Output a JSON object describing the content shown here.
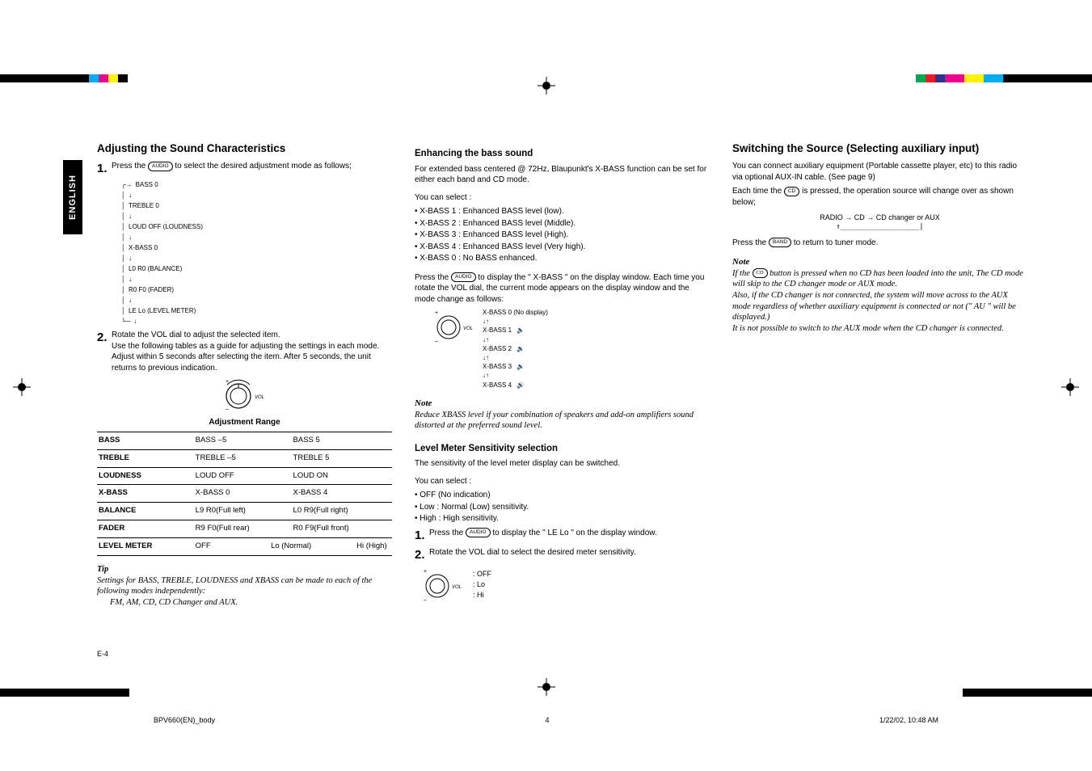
{
  "tab": {
    "label": "ENGLISH"
  },
  "col1": {
    "heading": "Adjusting the Sound Characteristics",
    "step1_pre": "Press the ",
    "step1_btn": "AUDIO",
    "step1_post": " to select the desired adjustment mode as follows;",
    "flow": [
      "BASS 0",
      "TREBLE 0",
      "LOUD OFF (LOUDNESS)",
      "X-BASS 0",
      "L0 R0 (BALANCE)",
      "R0 F0 (FADER)",
      "LE Lo (LEVEL METER)"
    ],
    "step2_a": "Rotate the VOL dial to adjust the selected item.",
    "step2_b": "Use the following tables as a guide for adjusting the settings in each mode.",
    "step2_c": "Adjust within 5 seconds after selecting the item. After 5 seconds, the unit returns to previous indication.",
    "vol_label": "VOL",
    "table_header": "Adjustment Range",
    "table": [
      {
        "n": "BASS",
        "l": "BASS –5",
        "r": "BASS  5"
      },
      {
        "n": "TREBLE",
        "l": "TREBLE –5",
        "r": "TREBLE  5"
      },
      {
        "n": "LOUDNESS",
        "l": "LOUD OFF",
        "r": "LOUD ON"
      },
      {
        "n": "X-BASS",
        "l": "X-BASS 0",
        "r": "X-BASS 4"
      },
      {
        "n": "BALANCE",
        "l": "L9 R0(Full left)",
        "r": "L0 R9(Full right)"
      },
      {
        "n": "FADER",
        "l": "R9 F0(Full rear)",
        "r": "R0 F9(Full front)"
      },
      {
        "n": "LEVEL METER",
        "l": "OFF",
        "m": "Lo (Normal)",
        "r": "Hi (High)"
      }
    ],
    "tip_hd": "Tip",
    "tip1": "Settings for BASS, TREBLE, LOUDNESS and XBASS can be made to each of the following modes independently:",
    "tip2": "FM, AM, CD, CD Changer and AUX."
  },
  "col2": {
    "h_enh": "Enhancing the bass sound",
    "enh_p": "For extended bass centered @ 72Hz, Blaupunkt's X-BASS function can be set for either each band and CD mode.",
    "sel_intro": "You can select :",
    "sel": [
      "X-BASS 1  :  Enhanced BASS level (low).",
      "X-BASS 2  :  Enhanced BASS level (Middle).",
      "X-BASS 3  :  Enhanced BASS level (High).",
      "X-BASS 4  :  Enhanced BASS level (Very high).",
      "X-BASS 0  :  No BASS enhanced."
    ],
    "press_pre": "Press the ",
    "press_btn": "AUDIO",
    "press_post": " to display the \" X-BASS \" on the display window. Each time you rotate the VOL dial, the current mode appears on the display window and the mode change as follows:",
    "vol_label": "VOL",
    "xbass_flow": [
      "X-BASS 0 (No display)",
      "X-BASS 1",
      "X-BASS 2",
      "X-BASS 3",
      "X-BASS 4"
    ],
    "note_hd": "Note",
    "note_body": "Reduce XBASS level if your combination of speakers and add-on amplifiers sound distorted at the preferred sound level.",
    "h_lvl": "Level Meter Sensitivity selection",
    "lvl_p": "The sensitivity of the level meter display can be switched.",
    "lvl_sel_intro": "You can select :",
    "lvl_sel": [
      "OFF (No indication)",
      "Low     : Normal (Low) sensitivity.",
      "High     : High sensitivity."
    ],
    "lvl_step1_pre": "Press the ",
    "lvl_step1_btn": "AUDIO",
    "lvl_step1_post": " to display the \" LE Lo \" on the display window.",
    "lvl_step2": "Rotate the VOL dial to select the desired meter sensitivity.",
    "meter_opts": [
      ": OFF",
      ": Lo",
      ": Hi"
    ]
  },
  "col3": {
    "heading": "Switching the Source (Selecting auxiliary input)",
    "p1": "You can connect auxiliary equipment (Portable cassette player, etc) to this radio via optional AUX-IN cable. (See page 9)",
    "p2_pre": "Each time the ",
    "p2_btn": "CD",
    "p2_post": " is pressed, the operation source will change over as shown below;",
    "src_chain": "RADIO → CD → CD changer or AUX",
    "press_pre": "Press the ",
    "press_btn": "BAND",
    "press_post": " to return to tuner mode.",
    "note_hd": "Note",
    "note1_pre": "If the ",
    "note1_btn": "CD",
    "note1_post": " button is pressed when no CD has been loaded into the unit, The CD mode will skip to the CD changer mode or AUX mode.",
    "note2": "Also, if the CD changer is not connected, the system will move across to the AUX mode regardless of whether auxiliary equipment is connected or not (\" AU \" will be displayed.)",
    "note3": "It is not possible to switch to the AUX mode when the CD changer is connected."
  },
  "footer": {
    "pagenum": "E-4"
  },
  "imposition": {
    "file": "BPV660(EN)_body",
    "num": "4",
    "ts": "1/22/02, 10:48 AM"
  }
}
